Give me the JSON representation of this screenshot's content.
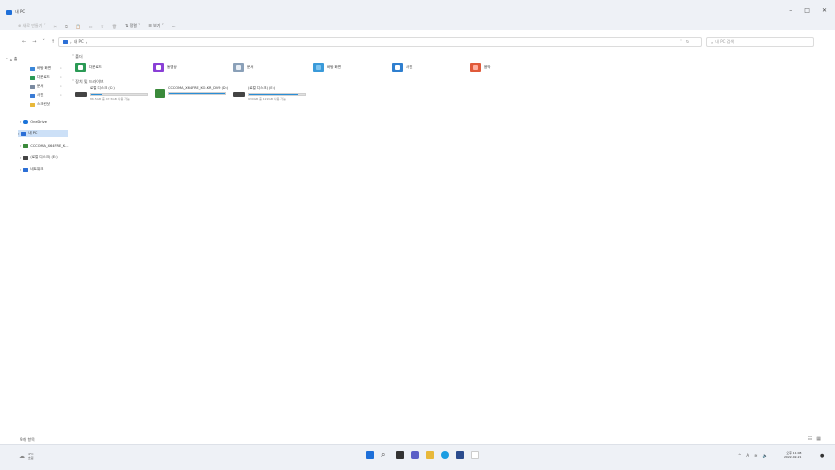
{
  "window": {
    "title": "내 PC",
    "controls": {
      "minimize": "–",
      "maximize": "□",
      "close": "✕"
    }
  },
  "toolbar": {
    "new": "⊕ 새로 만들기 ˅",
    "cut": "✂",
    "copy": "⧉",
    "paste": "📋",
    "rename": "▭",
    "share": "⇪",
    "delete": "🗑",
    "sort": "⇅ 정렬 ˅",
    "view": "☰ 보기 ˅",
    "more": "···"
  },
  "address": {
    "path": "내 PC",
    "chevron": "›",
    "dropdown": "˅",
    "refresh": "↻",
    "search_placeholder": "내 PC 검색"
  },
  "nav": {
    "back": "←",
    "forward": "→",
    "up": "↑",
    "recent": "˅"
  },
  "sidebar": {
    "home": "홈",
    "quick": [
      {
        "label": "바탕 화면",
        "color": "#3a86d8"
      },
      {
        "label": "다운로드",
        "color": "#2b9a55"
      },
      {
        "label": "문서",
        "color": "#7a8aa0"
      },
      {
        "label": "사진",
        "color": "#3a7bd5"
      },
      {
        "label": "스크린샷",
        "color": "#e8b83a"
      }
    ],
    "onedrive": "OneDrive",
    "this_pc": "내 PC",
    "usb": "CCCOMA_X64FRE_K...",
    "drive": "(로컬 디스크) (E:)",
    "network": "네트워크"
  },
  "main": {
    "folders_header": "폴더",
    "folders": [
      {
        "label": "다운로드",
        "color": "#2b9a55",
        "glyph": "#ffffff"
      },
      {
        "label": "동영상",
        "color": "#8a3fd6",
        "glyph": "#ffffff"
      },
      {
        "label": "문서",
        "color": "#8aa0b8",
        "glyph": "#e8eef5"
      },
      {
        "label": "바탕 화면",
        "color": "#3a9ad9",
        "glyph": "#7ec4f0"
      },
      {
        "label": "사진",
        "color": "#2f7fcf",
        "glyph": "#ffffff"
      },
      {
        "label": "음악",
        "color": "#e05a3a",
        "glyph": "#ffb0a0"
      }
    ],
    "drives_header": "장치 및 드라이브",
    "drives": [
      {
        "name": "로컬 디스크 (C:)",
        "free": "86.5GB 중 47.5GB 사용 가능",
        "used_fraction": 0.2
      },
      {
        "name": "CCCOMA_X64FRE_KO-KR_DV9 (D:)",
        "free": "",
        "used_fraction": 1.0
      },
      {
        "name": "(로컬 디스크) (E:)",
        "free": "930GB 중 122GB 사용 가능",
        "used_fraction": 0.87
      }
    ]
  },
  "status": {
    "items": "9개 항목",
    "view_details": "☷",
    "view_tiles": "▦"
  },
  "taskbar": {
    "weather_temp": "4°C",
    "weather_desc": "흐림",
    "apps": [
      {
        "name": "start",
        "color": "#1e6fd9"
      },
      {
        "name": "search",
        "color": "#555555"
      },
      {
        "name": "task-view",
        "color": "#333333"
      },
      {
        "name": "chat",
        "color": "#5b5fc7"
      },
      {
        "name": "file-explorer",
        "color": "#e8b83a"
      },
      {
        "name": "edge",
        "color": "#1b9de2"
      },
      {
        "name": "store",
        "color": "#2a4b8d"
      },
      {
        "name": "app",
        "color": "#dddddd"
      }
    ],
    "tray": {
      "chevron": "^",
      "lang": "A",
      "wifi": "≋",
      "volume": "🔈"
    },
    "time": "오후 11:08",
    "date": "2022-02-21"
  }
}
